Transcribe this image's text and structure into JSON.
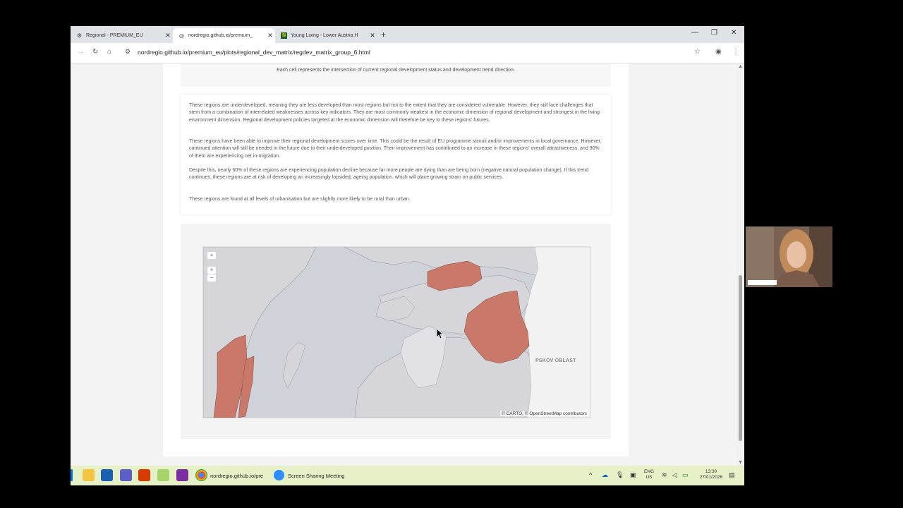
{
  "browser": {
    "tabs": [
      {
        "label": "Regional - PREMIUM_EU",
        "icon": "gear-icon",
        "active": false
      },
      {
        "label": "nordregio.github.io/premium_",
        "icon": "globe-icon",
        "active": true
      },
      {
        "label": "Young Living - Lower Austria H",
        "icon": "n-logo-icon",
        "active": false
      }
    ],
    "url": "nordregio.github.io/premium_eu/plots/regional_dev_matrix/regdev_matrix_group_6.html"
  },
  "page": {
    "caption": "Each cell represents the intersection of current regional development status and development trend direction.",
    "paragraphs": [
      "These regions are underdeveloped, meaning they are less developed than most regions but not to the extent that they are considered vulnerable. However, they still face challenges that stem from a combination of interrelated weaknesses across key indicators. They are most commonly weakest in the economic dimension of regional development and strongest in the living environment dimension. Regional development policies targeted at the economic dimension will therefore be key to these regions' futures.",
      "These regions have been able to improve their regional development scores over time. This could be the result of EU programme stimuli and/or improvements in local governance. However, continued attention will still be needed in the future due to their underdeveloped position. Their improvement has contributed to an increase in these regions' overall attractiveness, and 90% of them are experiencing net in-migration.",
      "Despite this, nearly 60% of these regions are experiencing population decline because far more people are dying than are being born (negative natural population change). If this trend continues, these regions are at risk of developing an increasingly lopsided, ageing population, which will place growing strain on public services.",
      "These regions are found at all levels of urbanisation but are slightly more likely to be rural than urban."
    ],
    "map": {
      "zoom_in": "+",
      "zoom_out": "−",
      "label": "PSKOV OBLAST",
      "attribution": "© CARTO, © OpenStreetMap contributors",
      "highlight_color": "#c9786a",
      "land_color": "#d6d6da",
      "sea_color": "#cfd2d8"
    }
  },
  "taskbar": {
    "chrome_label": "nordregio.github.io/pre",
    "meeting_label": "Screen Sharing Meeting",
    "lang_top": "ENG",
    "lang_bottom": "US",
    "time": "13:30",
    "date": "27/01/2026"
  }
}
